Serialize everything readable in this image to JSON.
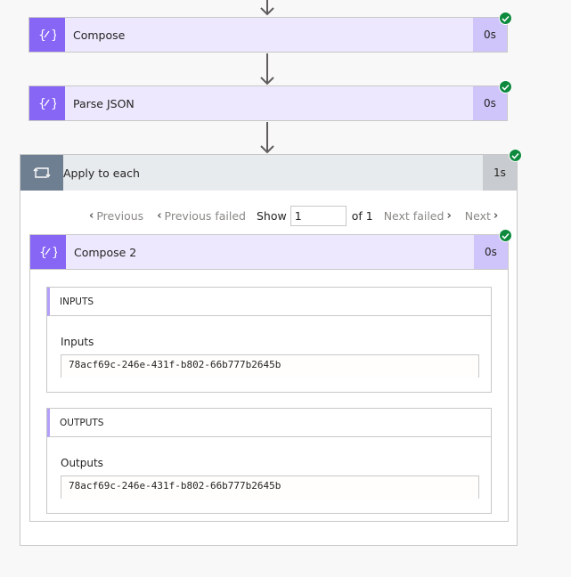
{
  "flow": {
    "steps": [
      {
        "title": "Compose",
        "duration": "0s",
        "status": "succeeded",
        "icon": "compose-icon"
      },
      {
        "title": "Parse JSON",
        "duration": "0s",
        "status": "succeeded",
        "icon": "compose-icon"
      }
    ],
    "apply_to_each": {
      "title": "Apply to each",
      "duration": "1s",
      "status": "succeeded",
      "icon": "loop-icon",
      "pager": {
        "previous_label": "Previous",
        "previous_failed_label": "Previous failed",
        "show_label": "Show",
        "current_value": "1",
        "of_label": "of 1",
        "next_failed_label": "Next failed",
        "next_label": "Next"
      },
      "inner_step": {
        "title": "Compose 2",
        "duration": "0s",
        "status": "succeeded",
        "icon": "compose-icon",
        "inputs": {
          "section_title": "INPUTS",
          "label": "Inputs",
          "value": "78acf69c-246e-431f-b802-66b777b2645b"
        },
        "outputs": {
          "section_title": "OUTPUTS",
          "label": "Outputs",
          "value": "78acf69c-246e-431f-b802-66b777b2645b"
        }
      }
    }
  },
  "colors": {
    "action_accent": "#8765f5",
    "action_bg": "#ede8fd",
    "duration_bg": "#d0c5fb",
    "loop_accent": "#6f7f92",
    "success": "#0d8a3e"
  }
}
